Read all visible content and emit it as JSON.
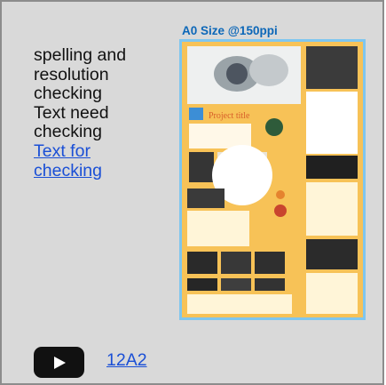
{
  "card": {
    "lines": [
      "spelling and",
      "resolution",
      "checking",
      "Text need",
      "checking"
    ],
    "link_lines": [
      "Text for",
      "checking"
    ]
  },
  "preview": {
    "label": "A0 Size @150ppi",
    "poster_heading": "Project title"
  },
  "video": {
    "icon": "youtube-play-icon",
    "link_text": "12A2"
  },
  "colors": {
    "card_bg": "#d9d9d9",
    "link": "#1a4fd6",
    "poster_accent": "#f6b73c",
    "frame_border": "#7fc6ef"
  }
}
